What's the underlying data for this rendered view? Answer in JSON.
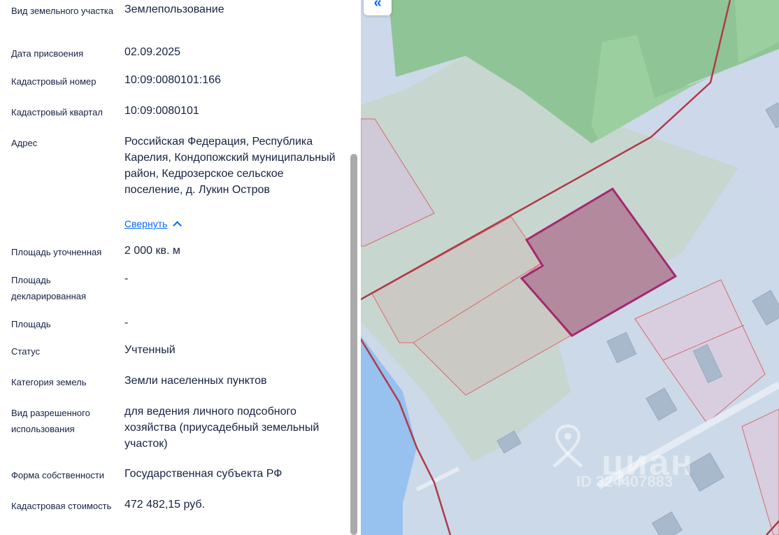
{
  "details": {
    "land_type": {
      "label": "Вид земельного участка",
      "value": "Землепользование"
    },
    "assigned_date": {
      "label": "Дата присвоения",
      "value": "02.09.2025"
    },
    "cadastral_number": {
      "label": "Кадастровый номер",
      "value": "10:09:0080101:166"
    },
    "cadastral_quarter": {
      "label": "Кадастровый квартал",
      "value": "10:09:0080101"
    },
    "address": {
      "label": "Адрес",
      "value": "Российская Федерация, Республика Карелия, Кондопожский муниципальный район, Кедрозерское сельское поселение, д. Лукин Остров",
      "collapse_label": "Свернуть"
    },
    "area_refined": {
      "label": "Площадь уточненная",
      "value": "2 000 кв. м"
    },
    "area_declared": {
      "label": "Площадь декларированная",
      "value": "-"
    },
    "area": {
      "label": "Площадь",
      "value": "-"
    },
    "status": {
      "label": "Статус",
      "value": "Учтенный"
    },
    "land_category": {
      "label": "Категория земель",
      "value": "Земли населенных пунктов"
    },
    "permitted_use": {
      "label": "Вид разрешенного использования",
      "value": "для ведения личного подсобного хозяйства (приусадебный земельный участок)"
    },
    "ownership": {
      "label": "Форма собственности",
      "value": "Государственная субъекта РФ"
    },
    "cadastral_value": {
      "label": "Кадастровая стоимость",
      "value": "472 482,15 руб."
    }
  },
  "map": {
    "collapse_button": "«",
    "watermark": "циан",
    "watermark_id": "ID 324407883",
    "colors": {
      "forest": "#8fc596",
      "water": "#97c1ef",
      "land": "#cdd8ea",
      "parcel_selected": "#b3899d",
      "parcel_border": "#a4296e",
      "boundary": "#b03a48"
    }
  }
}
